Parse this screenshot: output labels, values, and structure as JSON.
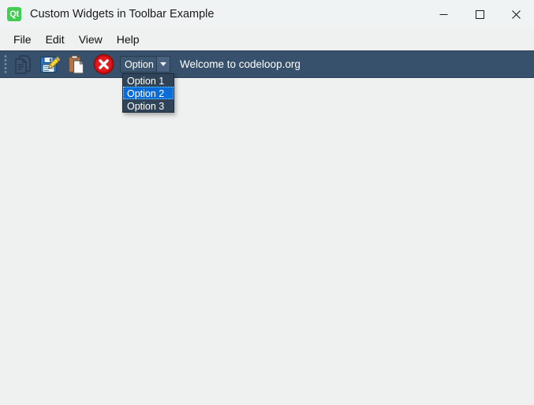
{
  "window": {
    "title": "Custom Widgets in Toolbar Example",
    "app_icon_label": "Qt",
    "accent_green": "#41cd52",
    "titlebar_bg": "#f0f3f4",
    "toolbar_bg": "#37506b",
    "content_bg": "#eff0f0",
    "highlight_blue": "#0a6cd8"
  },
  "window_controls": {
    "minimize": "minimize-icon",
    "maximize": "maximize-icon",
    "close": "close-icon"
  },
  "menubar": {
    "items": [
      {
        "label": "File"
      },
      {
        "label": "Edit"
      },
      {
        "label": "View"
      },
      {
        "label": "Help"
      }
    ]
  },
  "toolbar": {
    "drag_handle": "drag-handle-dots",
    "buttons": [
      {
        "name": "new-document-button",
        "icon": "documents-icon",
        "label": "New"
      },
      {
        "name": "save-button",
        "icon": "save-edit-icon",
        "label": "Save"
      },
      {
        "name": "paste-button",
        "icon": "clipboard-paste-icon",
        "label": "Paste"
      },
      {
        "name": "delete-button",
        "icon": "red-close-circle-icon",
        "label": "Delete"
      }
    ],
    "combo": {
      "selected_value": "Option",
      "arrow_icon": "chevron-down-icon",
      "options": [
        {
          "label": "Option 1",
          "selected": false
        },
        {
          "label": "Option 2",
          "selected": true
        },
        {
          "label": "Option 3",
          "selected": false
        }
      ]
    },
    "status_label": "Welcome to codeloop.org"
  }
}
